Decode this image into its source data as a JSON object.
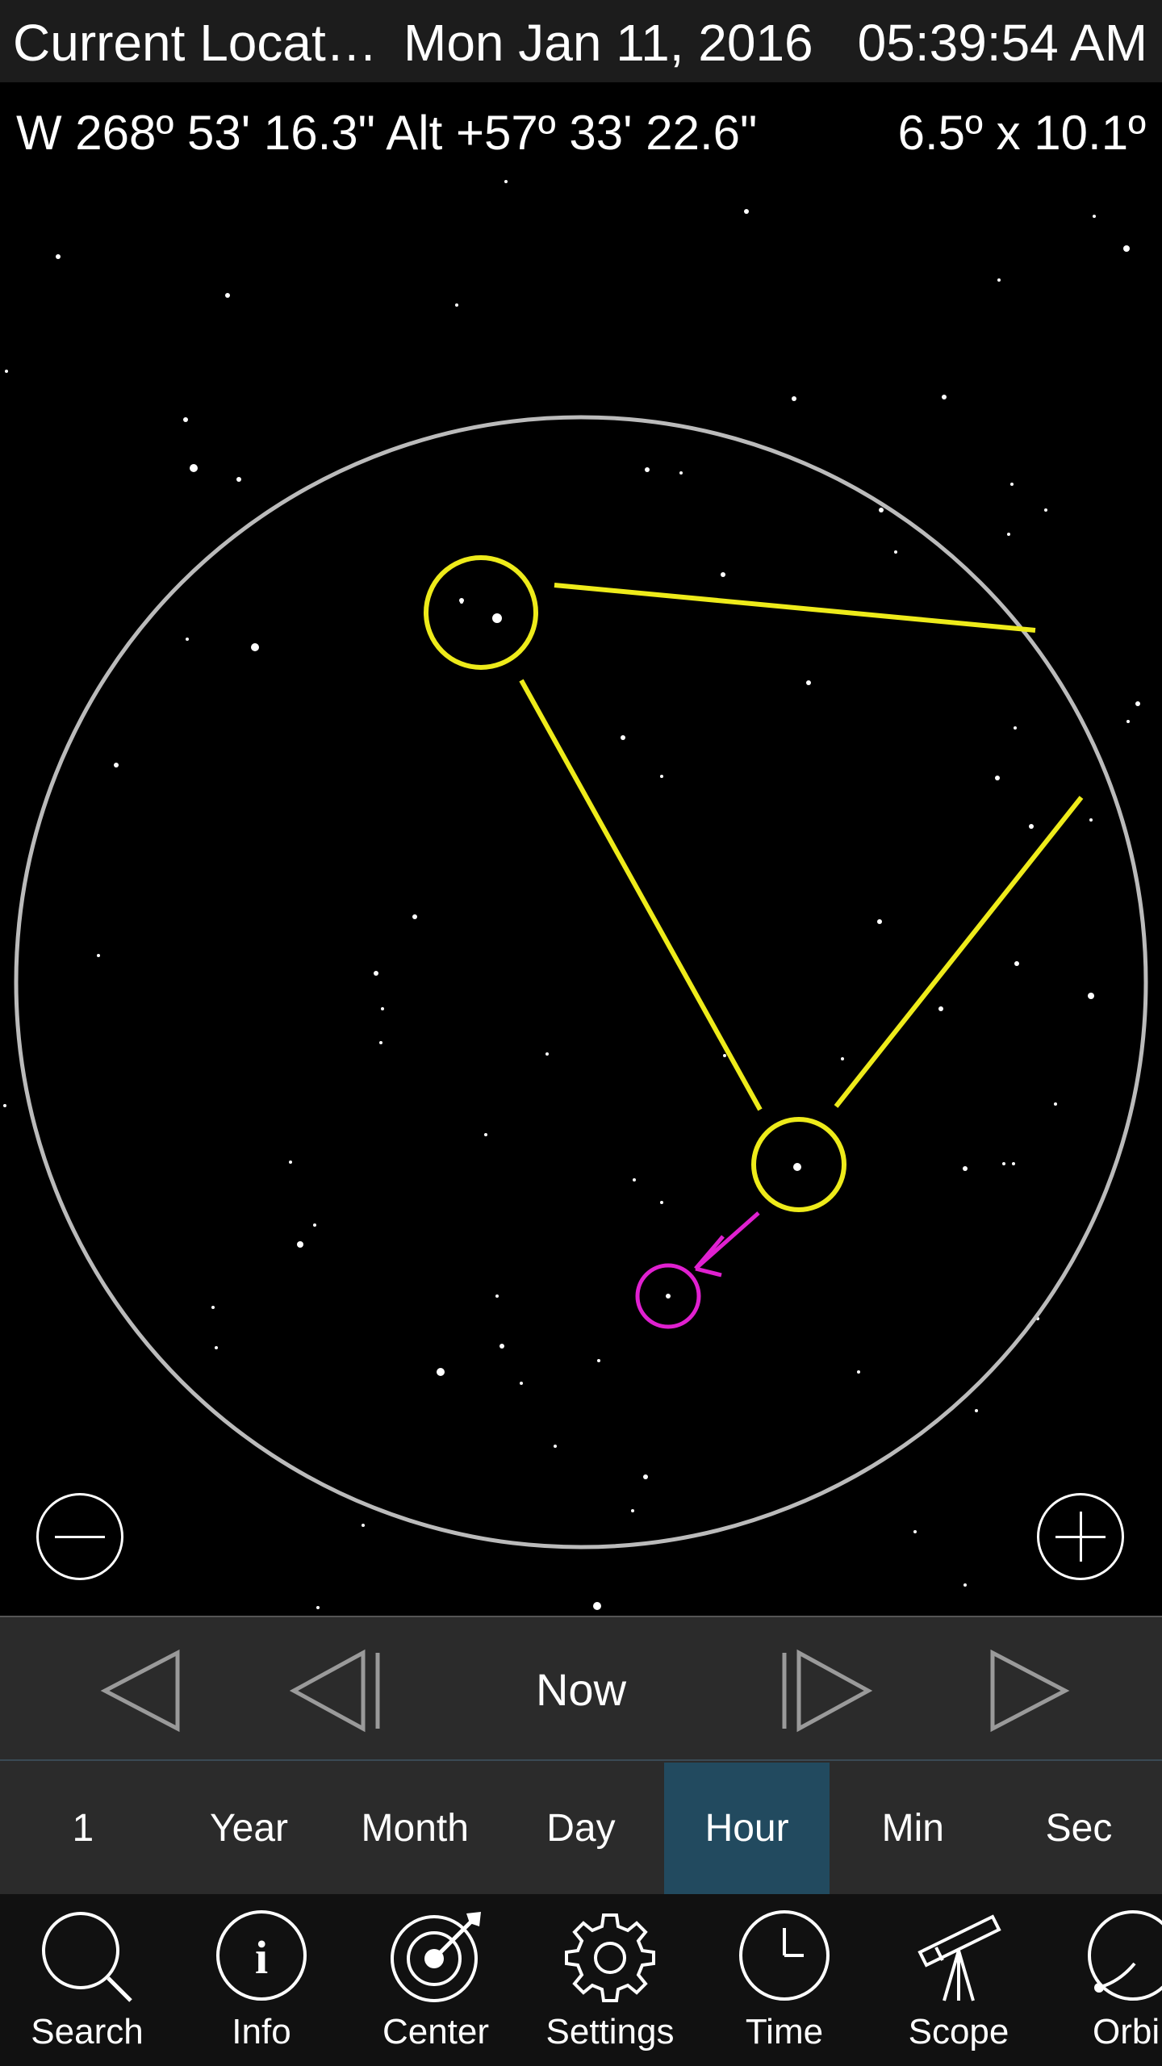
{
  "header": {
    "location": "Current Locat…",
    "date": "Mon Jan 11, 2016",
    "time": "05:39:54 AM"
  },
  "coordinates": {
    "position": "W 268º 53' 16.3\" Alt +57º 33' 22.6\"",
    "field_of_view": "6.5º x 10.1º"
  },
  "colors": {
    "constellation_lines": "#eeeb1a",
    "planet_marker": "#e020d0",
    "fov_circle": "#bbbbbb",
    "active_unit": "#224a5f"
  },
  "zoom": {
    "out_icon": "minus-icon",
    "in_icon": "plus-icon"
  },
  "time_controls": {
    "now_label": "Now",
    "units": [
      "1",
      "Year",
      "Month",
      "Day",
      "Hour",
      "Min",
      "Sec"
    ],
    "active_unit": "Hour"
  },
  "toolbar": {
    "items": [
      {
        "label": "Search",
        "icon": "search-icon"
      },
      {
        "label": "Info",
        "icon": "info-icon"
      },
      {
        "label": "Center",
        "icon": "target-icon"
      },
      {
        "label": "Settings",
        "icon": "gear-icon"
      },
      {
        "label": "Time",
        "icon": "clock-icon"
      },
      {
        "label": "Scope",
        "icon": "telescope-icon"
      },
      {
        "label": "Orbi",
        "icon": "orbit-icon"
      }
    ]
  }
}
